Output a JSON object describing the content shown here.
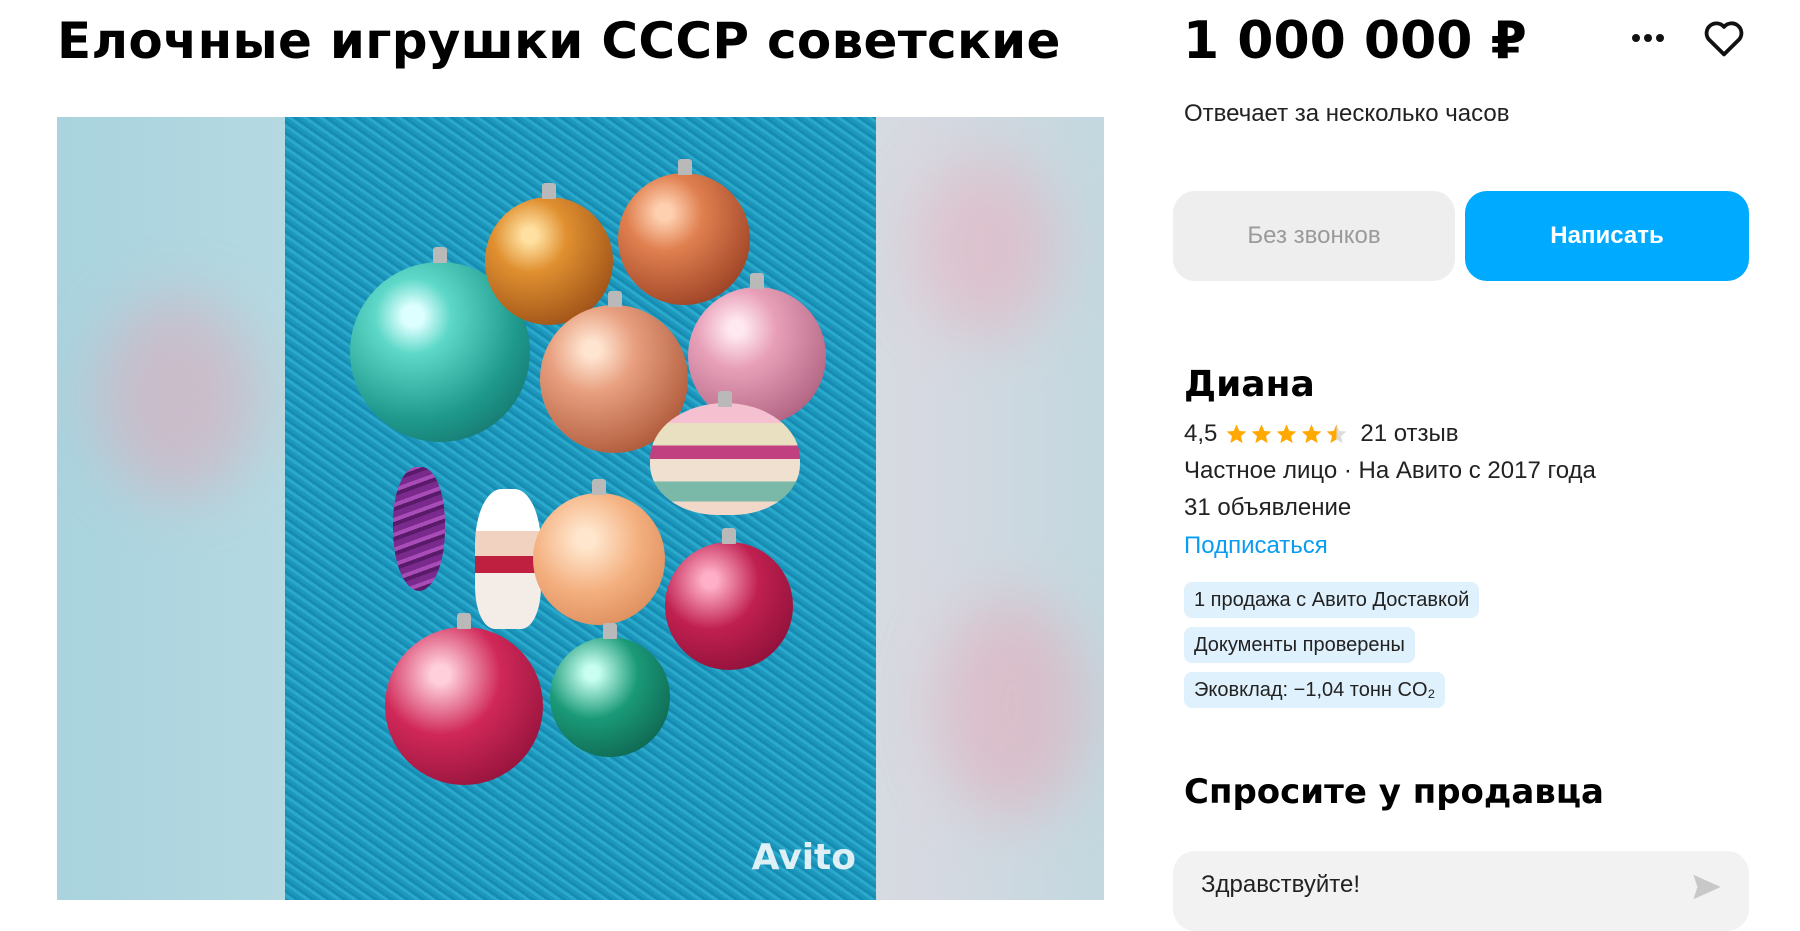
{
  "listing": {
    "title": "Елочные игрушки СССР советские",
    "price": "1 000 000 ₽",
    "reply_time": "Отвечает за несколько часов",
    "photo_watermark": "Avito"
  },
  "actions": {
    "no_calls_label": "Без звонков",
    "write_label": "Написать",
    "more_icon": "more-dots-icon",
    "favorite_icon": "heart-icon"
  },
  "seller": {
    "name": "Диана",
    "rating": "4,5",
    "rating_value": 4.5,
    "reviews": "21 отзыв",
    "type_since": "Частное лицо · На Авито с 2017 года",
    "ads_count": "31 объявление",
    "subscribe_label": "Подписаться",
    "badges": [
      "1 продажа с Авито Доставкой",
      "Документы проверены",
      "Эковклад: −1,04 тонн CO₂"
    ]
  },
  "ask": {
    "title": "Спросите у продавца",
    "message_value": "Здравствуйте!"
  },
  "colors": {
    "accent": "#00aaff",
    "link": "#0a9cf0",
    "star": "#ffa800",
    "badge_bg": "#dff1fc",
    "button_gray": "#eeeeee"
  }
}
